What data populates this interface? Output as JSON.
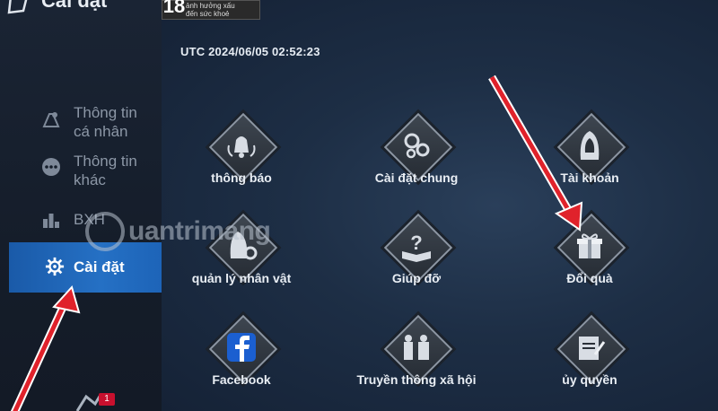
{
  "header": {
    "title": "Cài đặt",
    "age_rating": "18",
    "age_warning_line1": "ảnh hưởng xấu",
    "age_warning_line2": "đến sức khoẻ",
    "utc_time": "UTC 2024/06/05 02:52:23"
  },
  "sidebar": {
    "items": [
      {
        "label_line1": "Thông tin",
        "label_line2": "cá nhân",
        "icon": "profile-icon"
      },
      {
        "label_line1": "Thông tin",
        "label_line2": "khác",
        "icon": "more-icon"
      },
      {
        "label_line1": "BXH",
        "icon": "leaderboard-icon"
      },
      {
        "label_line1": "Cài đặt",
        "icon": "gear-icon",
        "active": true
      }
    ],
    "notification_badge": "1"
  },
  "grid": {
    "tiles": [
      {
        "label": "thông báo",
        "icon": "bell-icon"
      },
      {
        "label": "Cài đặt chung",
        "icon": "gears-icon"
      },
      {
        "label": "Tài khoản",
        "icon": "hooded-figure-icon"
      },
      {
        "label": "quản lý nhân vật",
        "icon": "character-settings-icon"
      },
      {
        "label": "Giúp đỡ",
        "icon": "help-book-icon"
      },
      {
        "label": "Đổi quà",
        "icon": "gift-icon"
      },
      {
        "label": "Facebook",
        "icon": "facebook-icon"
      },
      {
        "label": "Truyền thông xã hội",
        "icon": "social-media-icon"
      },
      {
        "label": "ủy quyền",
        "icon": "authorization-icon"
      }
    ]
  },
  "watermark": {
    "text": "uantrimang"
  },
  "colors": {
    "accent": "#2570c4",
    "arrow": "#e0222b",
    "background": "#1d2e45"
  }
}
